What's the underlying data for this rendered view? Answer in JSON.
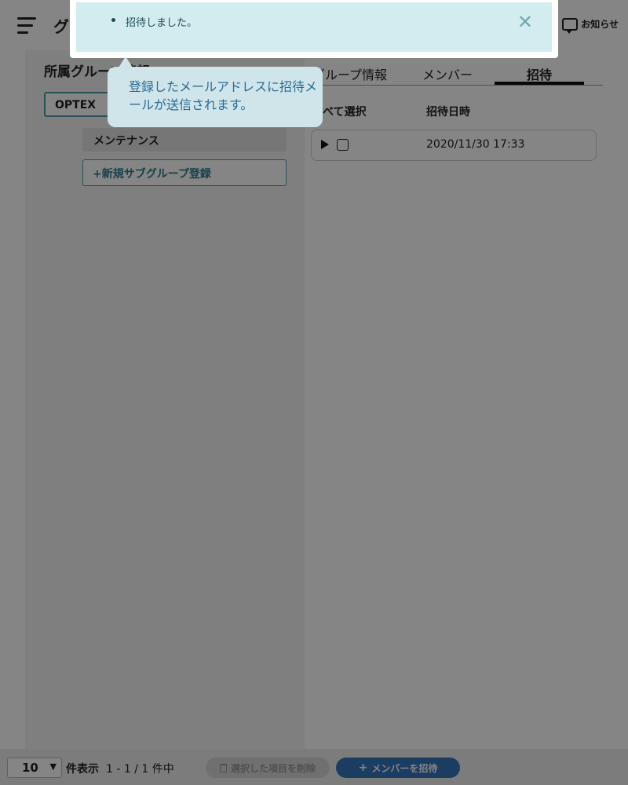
{
  "header": {
    "title": "グループ情報",
    "notice_label": "お知らせ"
  },
  "left": {
    "heading": "所属グループ情報",
    "root_group": "OPTEX",
    "subgroups": [
      "メンテナンス"
    ],
    "add_subgroup_label": "+新規サブグループ登録"
  },
  "tabs": {
    "info": "グループ情報",
    "members": "メンバー",
    "invite": "招待",
    "active": "招待"
  },
  "invites_table": {
    "select_all": "すべて選択",
    "date_header": "招待日時",
    "rows": [
      {
        "date": "2020/11/30 17:33"
      }
    ]
  },
  "footer": {
    "per_page": "10",
    "per_page_label": "件表示",
    "page_info": "1 - 1 / 1 件中",
    "delete_label": "選択した項目を削除",
    "invite_label": "メンバーを招待"
  },
  "alert": {
    "message": "招待しました。"
  },
  "tooltip": {
    "text": "登録したメールアドレスに招待メールが送信されます。"
  },
  "colors": {
    "accent": "#4e9aa8",
    "primary_button": "#3476bc",
    "alert_bg": "#d3ecef",
    "tooltip_bg": "#d0e5ea"
  },
  "icons": [
    "menu-icon",
    "notice-icon",
    "expand-icon",
    "trash-icon",
    "plus-icon",
    "close-icon",
    "chevron-down-icon"
  ]
}
